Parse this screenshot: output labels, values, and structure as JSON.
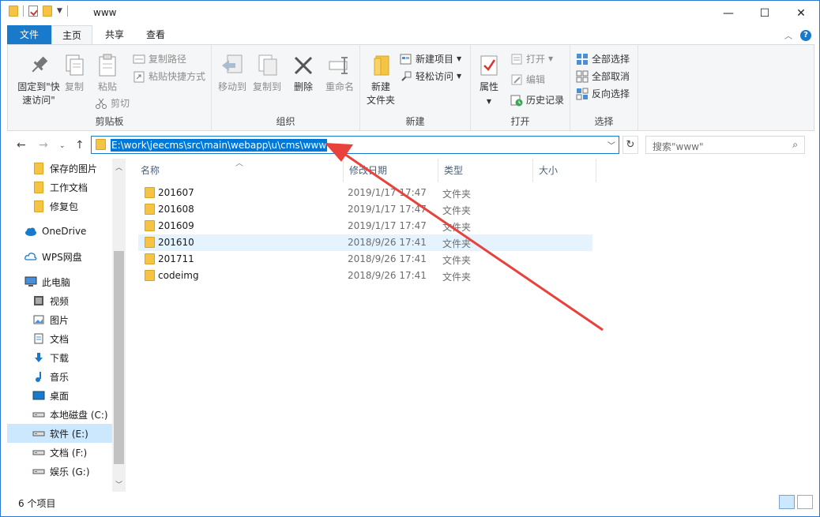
{
  "window": {
    "title": "www"
  },
  "tabs": {
    "file": "文件",
    "home": "主页",
    "share": "共享",
    "view": "查看"
  },
  "ribbon": {
    "clipboard": {
      "label": "剪贴板",
      "pin_line1": "固定到\"快",
      "pin_line2": "速访问\"",
      "copy": "复制",
      "paste": "粘贴",
      "copy_path": "复制路径",
      "paste_shortcut": "粘贴快捷方式",
      "cut": "剪切"
    },
    "organize": {
      "label": "组织",
      "move_to": "移动到",
      "copy_to": "复制到",
      "delete": "删除",
      "rename": "重命名"
    },
    "new": {
      "label": "新建",
      "new_folder_line1": "新建",
      "new_folder_line2": "文件夹",
      "new_item": "新建项目",
      "easy_access": "轻松访问"
    },
    "open": {
      "label": "打开",
      "properties": "属性",
      "open": "打开",
      "edit": "编辑",
      "history": "历史记录"
    },
    "select": {
      "label": "选择",
      "select_all": "全部选择",
      "select_none": "全部取消",
      "invert": "反向选择"
    }
  },
  "address": {
    "path": "E:\\work\\jeecms\\src\\main\\webapp\\u\\cms\\www",
    "search_placeholder": "搜索\"www\""
  },
  "nav": {
    "items": [
      {
        "label": "保存的图片",
        "icon": "folder-icon"
      },
      {
        "label": "工作文档",
        "icon": "folder-icon"
      },
      {
        "label": "修复包",
        "icon": "folder-icon"
      },
      {
        "label": "OneDrive",
        "icon": "cloud-icon"
      },
      {
        "label": "WPS网盘",
        "icon": "cloud-outline-icon"
      },
      {
        "label": "此电脑",
        "icon": "computer-icon"
      },
      {
        "label": "视频",
        "icon": "video-icon"
      },
      {
        "label": "图片",
        "icon": "picture-icon"
      },
      {
        "label": "文档",
        "icon": "document-icon"
      },
      {
        "label": "下载",
        "icon": "download-icon"
      },
      {
        "label": "音乐",
        "icon": "music-icon"
      },
      {
        "label": "桌面",
        "icon": "desktop-icon"
      },
      {
        "label": "本地磁盘 (C:)",
        "icon": "drive-icon"
      },
      {
        "label": "软件 (E:)",
        "icon": "drive-icon"
      },
      {
        "label": "文档 (F:)",
        "icon": "drive-icon"
      },
      {
        "label": "娱乐 (G:)",
        "icon": "drive-icon"
      }
    ]
  },
  "columns": {
    "name": "名称",
    "modified": "修改日期",
    "type": "类型",
    "size": "大小"
  },
  "files": [
    {
      "name": "201607",
      "modified": "2019/1/17 17:47",
      "type": "文件夹"
    },
    {
      "name": "201608",
      "modified": "2019/1/17 17:47",
      "type": "文件夹"
    },
    {
      "name": "201609",
      "modified": "2019/1/17 17:47",
      "type": "文件夹"
    },
    {
      "name": "201610",
      "modified": "2018/9/26 17:41",
      "type": "文件夹"
    },
    {
      "name": "201711",
      "modified": "2018/9/26 17:41",
      "type": "文件夹"
    },
    {
      "name": "codeimg",
      "modified": "2018/9/26 17:41",
      "type": "文件夹"
    }
  ],
  "status": {
    "count": "6 个项目"
  },
  "colors": {
    "accent": "#1979ca",
    "arrow": "#e8423c",
    "selection": "#0078d7",
    "hover_row": "#e5f3ff",
    "folder": "#f6c445"
  }
}
